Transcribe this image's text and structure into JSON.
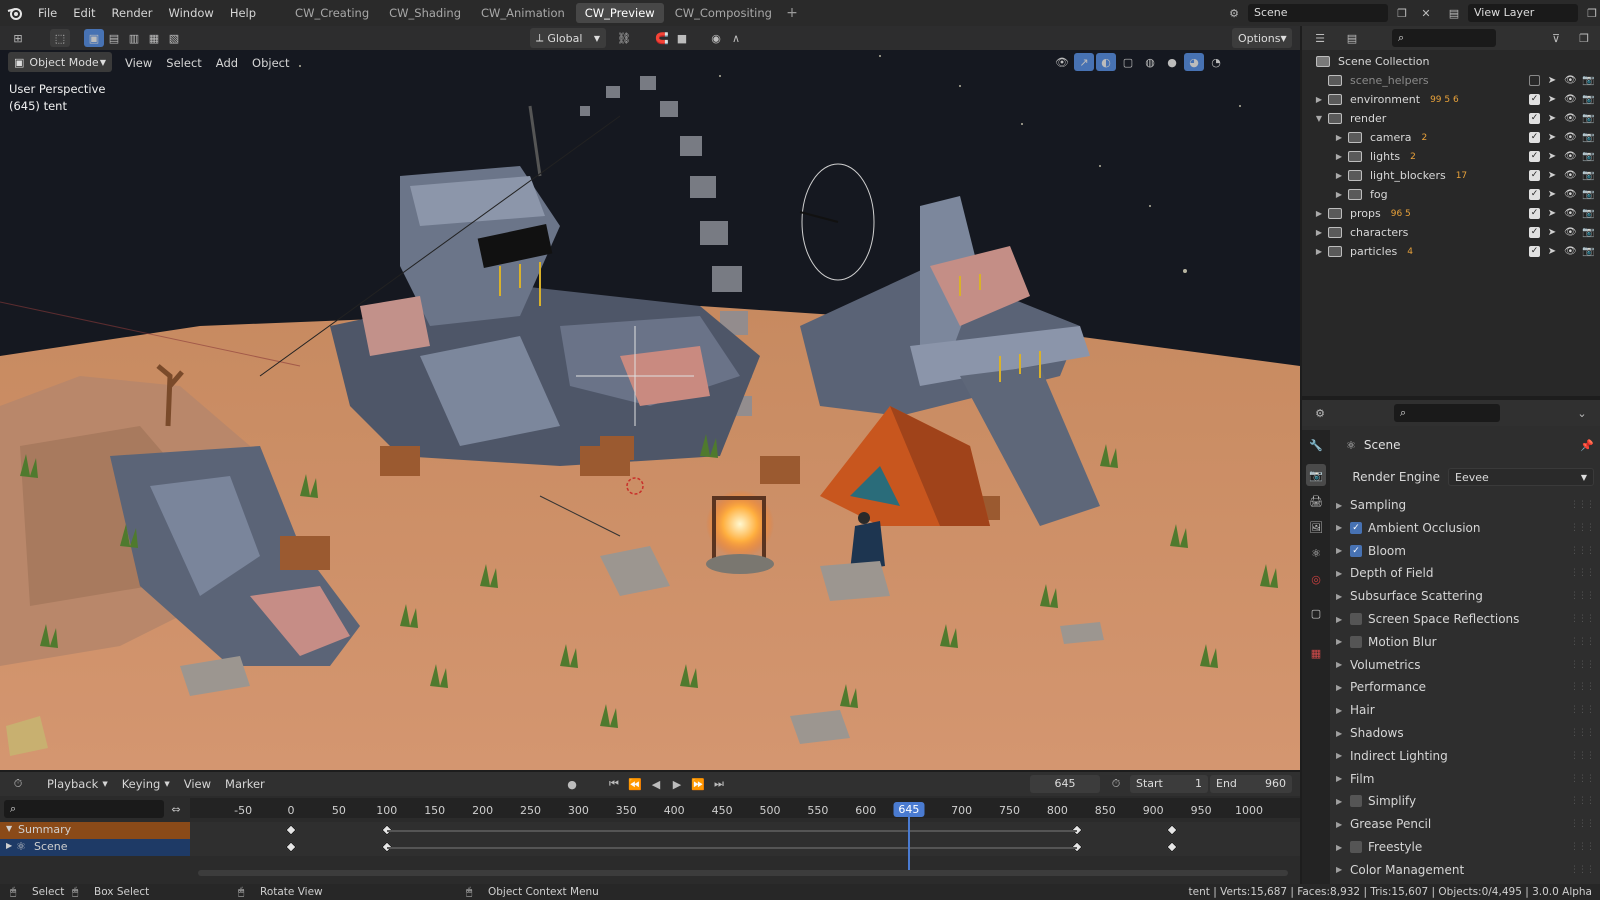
{
  "topbar": {
    "menus": [
      "File",
      "Edit",
      "Render",
      "Window",
      "Help"
    ],
    "workspaces": [
      "CW_Creating",
      "CW_Shading",
      "CW_Animation",
      "CW_Preview",
      "CW_Compositing"
    ],
    "active_workspace": "CW_Preview",
    "add_tab": "+",
    "scene_name": "Scene",
    "view_layer": "View Layer"
  },
  "viewport": {
    "mode": "Object Mode",
    "menus": [
      "View",
      "Select",
      "Add",
      "Object"
    ],
    "transform_orientation": "Global",
    "options": "Options",
    "overlay_title": "User Perspective",
    "overlay_sub": "(645) tent"
  },
  "outliner": {
    "root": "Scene Collection",
    "rows": [
      {
        "label": "scene_helpers",
        "indent": 0,
        "arrow": "",
        "counts": "",
        "dim": true
      },
      {
        "label": "environment",
        "indent": 0,
        "arrow": "▶",
        "counts": "99 5 6"
      },
      {
        "label": "render",
        "indent": 0,
        "arrow": "▼",
        "counts": ""
      },
      {
        "label": "camera",
        "indent": 1,
        "arrow": "▶",
        "counts": "2"
      },
      {
        "label": "lights",
        "indent": 1,
        "arrow": "▶",
        "counts": "2"
      },
      {
        "label": "light_blockers",
        "indent": 1,
        "arrow": "▶",
        "counts": "17"
      },
      {
        "label": "fog",
        "indent": 1,
        "arrow": "▶",
        "counts": ""
      },
      {
        "label": "props",
        "indent": 0,
        "arrow": "▶",
        "counts": "96 5"
      },
      {
        "label": "characters",
        "indent": 0,
        "arrow": "▶",
        "counts": ""
      },
      {
        "label": "particles",
        "indent": 0,
        "arrow": "▶",
        "counts": "4"
      }
    ]
  },
  "properties": {
    "context": "Scene",
    "render_engine_label": "Render Engine",
    "render_engine": "Eevee",
    "panels": [
      {
        "label": "Sampling",
        "checkbox": null
      },
      {
        "label": "Ambient Occlusion",
        "checkbox": true
      },
      {
        "label": "Bloom",
        "checkbox": true
      },
      {
        "label": "Depth of Field",
        "checkbox": null
      },
      {
        "label": "Subsurface Scattering",
        "checkbox": null
      },
      {
        "label": "Screen Space Reflections",
        "checkbox": false
      },
      {
        "label": "Motion Blur",
        "checkbox": false
      },
      {
        "label": "Volumetrics",
        "checkbox": null
      },
      {
        "label": "Performance",
        "checkbox": null
      },
      {
        "label": "Hair",
        "checkbox": null
      },
      {
        "label": "Shadows",
        "checkbox": null
      },
      {
        "label": "Indirect Lighting",
        "checkbox": null
      },
      {
        "label": "Film",
        "checkbox": null
      },
      {
        "label": "Simplify",
        "checkbox": false
      },
      {
        "label": "Grease Pencil",
        "checkbox": null
      },
      {
        "label": "Freestyle",
        "checkbox": false
      },
      {
        "label": "Color Management",
        "checkbox": null
      }
    ]
  },
  "timeline": {
    "menus": [
      "Playback",
      "Keying",
      "View",
      "Marker"
    ],
    "current_frame": "645",
    "start_label": "Start",
    "start": "1",
    "end_label": "End",
    "end": "960",
    "ticks": [
      "-50",
      "0",
      "50",
      "100",
      "150",
      "200",
      "250",
      "300",
      "350",
      "400",
      "450",
      "500",
      "550",
      "600",
      "645",
      "700",
      "750",
      "800",
      "850",
      "900",
      "950",
      "1000"
    ],
    "channels": [
      "Summary",
      "Scene"
    ],
    "keyframes": [
      0,
      100,
      820,
      920
    ]
  },
  "statusbar": {
    "select": "Select",
    "box_select": "Box Select",
    "rotate_view": "Rotate View",
    "context_menu": "Object Context Menu",
    "stats": "tent | Verts:15,687 | Faces:8,932 | Tris:15,607 | Objects:0/4,495 | 3.0.0 Alpha"
  },
  "colors": {
    "accent": "#4772b3",
    "timeline_cursor": "#4a7bd1",
    "summary_row": "#8a4a18",
    "scene_row": "#1e3a66"
  }
}
